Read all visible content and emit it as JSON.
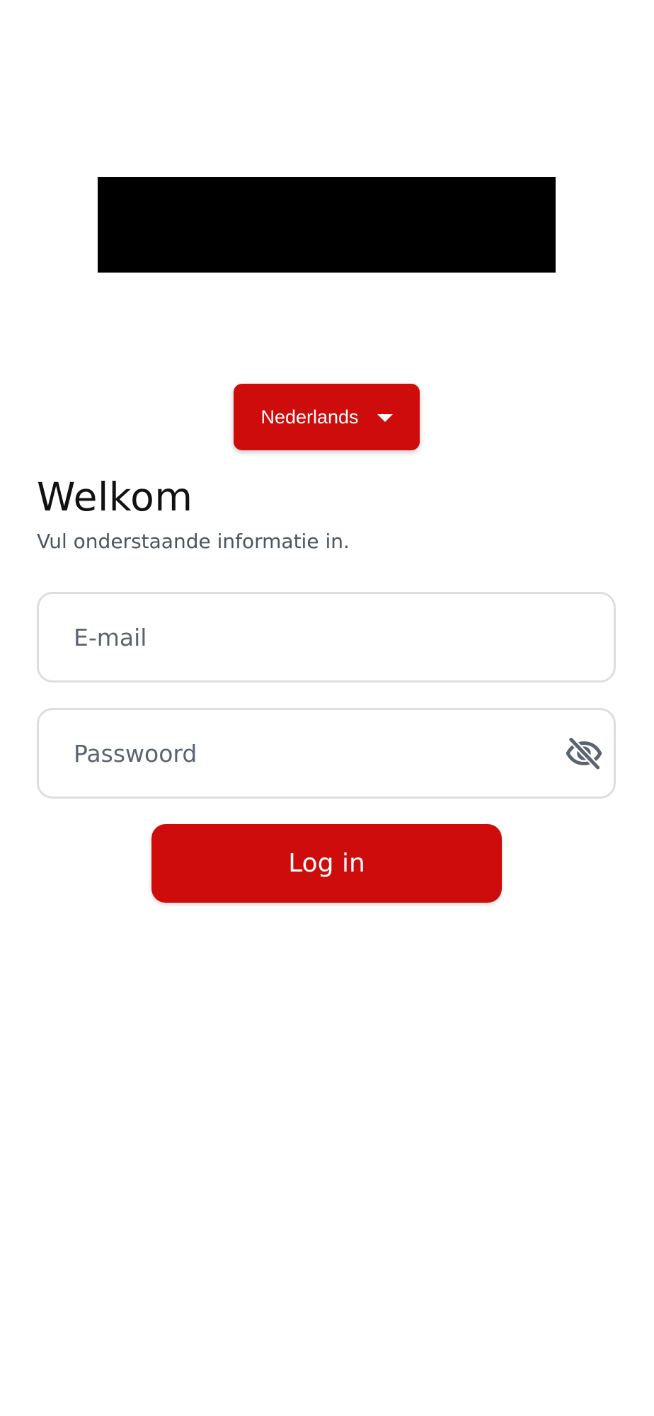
{
  "language_selector": {
    "label": "Nederlands",
    "icon": "caret-down-icon"
  },
  "header": {
    "title": "Welkom",
    "subtitle": "Vul onderstaande informatie in."
  },
  "form": {
    "email": {
      "value": "",
      "placeholder": "E-mail"
    },
    "password": {
      "value": "",
      "placeholder": "Passwoord",
      "toggle_icon": "eye-off-icon"
    },
    "login_label": "Log in"
  },
  "colors": {
    "accent": "#cf0c0c",
    "field_border": "#dedde2",
    "subtitle_text": "#4a5561",
    "logo_block": "#000000"
  }
}
